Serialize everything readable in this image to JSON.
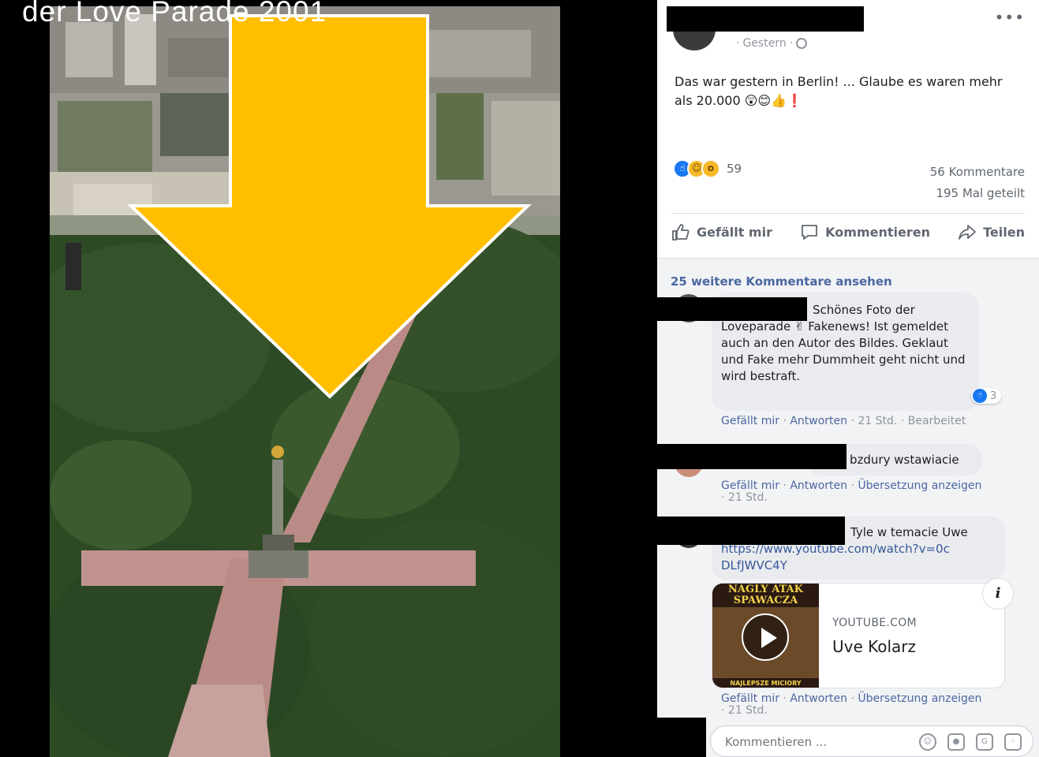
{
  "overlay": {
    "caption": "der Love Parade 2001",
    "arrow_color": "#ffbf00"
  },
  "post": {
    "timestamp": "Gestern",
    "text": "Das war gestern in Berlin! ... Glaube es waren mehr als 20.000",
    "emoji": "😲😊👍❗",
    "reaction_icons": [
      "like-icon",
      "haha-icon",
      "wow-icon"
    ],
    "reaction_count": "59",
    "comments_count": "56 Kommentare",
    "shares_count": "195 Mal geteilt",
    "more_label": "•••"
  },
  "actions": {
    "like": "Gefällt mir",
    "comment": "Kommentieren",
    "share": "Teilen"
  },
  "comments_section": {
    "more_comments": "25 weitere Kommentare ansehen",
    "items": [
      {
        "text_line1": "Schönes Foto der",
        "text_rest": "Loveparade ✌ Fakenews! Ist gemeldet auch an den Autor des Bildes. Geklaut und Fake mehr Dummheit geht nicht und wird bestraft.",
        "likes": "3",
        "meta_like": "Gefällt mir",
        "meta_reply": "Antworten",
        "meta_time": "21 Std.",
        "meta_extra": "Bearbeitet"
      },
      {
        "text": "bzdury wstawiacie",
        "meta_like": "Gefällt mir",
        "meta_reply": "Antworten",
        "meta_translate": "Übersetzung anzeigen",
        "meta_time": "21 Std."
      },
      {
        "text": "Tyle w temacie Uwe",
        "link": "https://www.youtube.com/watch?v=0cDLfJWVC4Y",
        "meta_like": "Gefällt mir",
        "meta_reply": "Antworten",
        "meta_translate": "Übersetzung anzeigen",
        "meta_time": "21 Std."
      }
    ]
  },
  "link_card": {
    "domain": "YOUTUBE.COM",
    "title": "Uve Kolarz",
    "thumb_title": "NAGLY ATAK SPAWACZA",
    "thumb_footer": "NAJLEPSZE MICIORY",
    "info": "i"
  },
  "composer": {
    "placeholder": "Kommentieren ...",
    "icons": [
      "emoji-icon",
      "camera-icon",
      "gif-icon",
      "sticker-icon"
    ]
  }
}
